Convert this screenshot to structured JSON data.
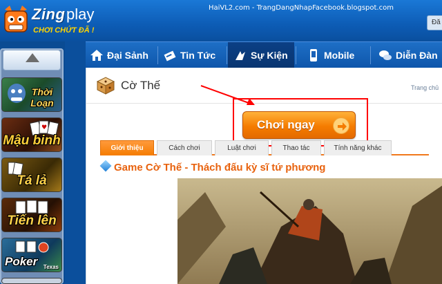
{
  "header": {
    "logo_brand": "Zing",
    "logo_suffix": "play",
    "logo_tagline": "CHƠI CHỨT ĐÃ !",
    "watermark": "HaiVL2.com - TrangDangNhapFacebook.blogspot.com",
    "corner_button": "Đă"
  },
  "sidebar": {
    "games": [
      {
        "label": "Thời Loạn",
        "icon": "thoi-loan-game-icon"
      },
      {
        "label": "Mậu binh",
        "icon": "mau-binh-game-icon"
      },
      {
        "label": "Tá lả",
        "icon": "ta-la-game-icon"
      },
      {
        "label": "Tiến lên",
        "icon": "tien-len-game-icon"
      },
      {
        "label": "Poker",
        "sublabel": "Texas",
        "icon": "poker-game-icon"
      }
    ]
  },
  "nav": {
    "items": [
      {
        "label": "Đại Sảnh",
        "icon": "home-icon"
      },
      {
        "label": "Tin Tức",
        "icon": "news-icon"
      },
      {
        "label": "Sự Kiện",
        "icon": "event-icon",
        "active": true
      },
      {
        "label": "Mobile",
        "icon": "mobile-icon"
      },
      {
        "label": "Diễn Đàn",
        "icon": "forum-icon"
      }
    ]
  },
  "content": {
    "page_title": "Cờ Thế",
    "breadcrumb": "Trang chủ",
    "play_button": "Chơi ngay",
    "tabs": [
      {
        "label": "Giới thiệu",
        "active": true
      },
      {
        "label": "Cách chơi"
      },
      {
        "label": "Luật chơi"
      },
      {
        "label": "Thao tác"
      },
      {
        "label": "Tính năng khác"
      }
    ],
    "heading": "Game Cờ Thế - Thách đấu kỳ sĩ tứ phương"
  },
  "colors": {
    "accent_orange": "#f57c00",
    "nav_blue": "#0e56ab",
    "highlight_red": "#ff0000",
    "heading_orange": "#e8620e"
  }
}
